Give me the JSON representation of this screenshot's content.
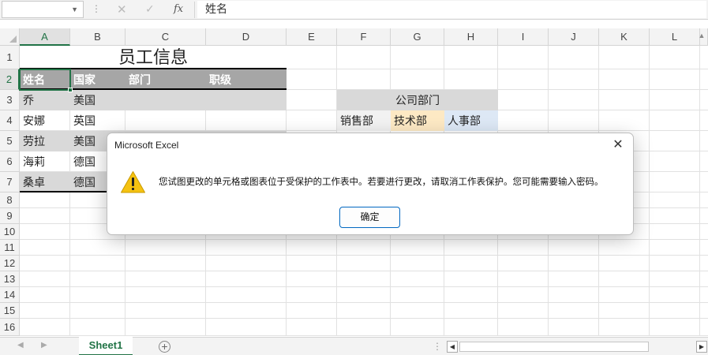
{
  "formula_bar": {
    "name_box": "",
    "cancel_icon": "✕",
    "enter_icon": "✓",
    "fx_label": "fx",
    "content": "姓名"
  },
  "columns": [
    "A",
    "B",
    "C",
    "D",
    "E",
    "F",
    "G",
    "H",
    "I",
    "J",
    "K",
    "L"
  ],
  "rows": [
    "1",
    "2",
    "3",
    "4",
    "5",
    "6",
    "7",
    "8",
    "9",
    "10",
    "11",
    "12",
    "13",
    "14",
    "15",
    "16"
  ],
  "cells": {
    "title": "员工信息",
    "headers": [
      "姓名",
      "国家",
      "部门",
      "职级"
    ],
    "names": [
      "乔",
      "安娜",
      "劳拉",
      "海莉",
      "桑卓"
    ],
    "countries": [
      "美国",
      "英国",
      "美国",
      "德国",
      "德国"
    ],
    "dept_header": "公司部门",
    "depts": [
      "销售部",
      "技术部",
      "人事部"
    ]
  },
  "sheet_tabs": {
    "active": "Sheet1"
  },
  "dialog": {
    "title": "Microsoft Excel",
    "message": "您试图更改的单元格或图表位于受保护的工作表中。若要进行更改，请取消工作表保护。您可能需要输入密码。",
    "ok_label": "确定",
    "icon": "warning-icon",
    "close_icon": "✕"
  },
  "colors": {
    "accent": "#217346",
    "header_fill": "#a6a6a6",
    "band_fill": "#d9d9d9",
    "dept_sales": "#f2f2f2",
    "dept_tech": "#fde9c4",
    "dept_hr": "#dde8f5"
  }
}
